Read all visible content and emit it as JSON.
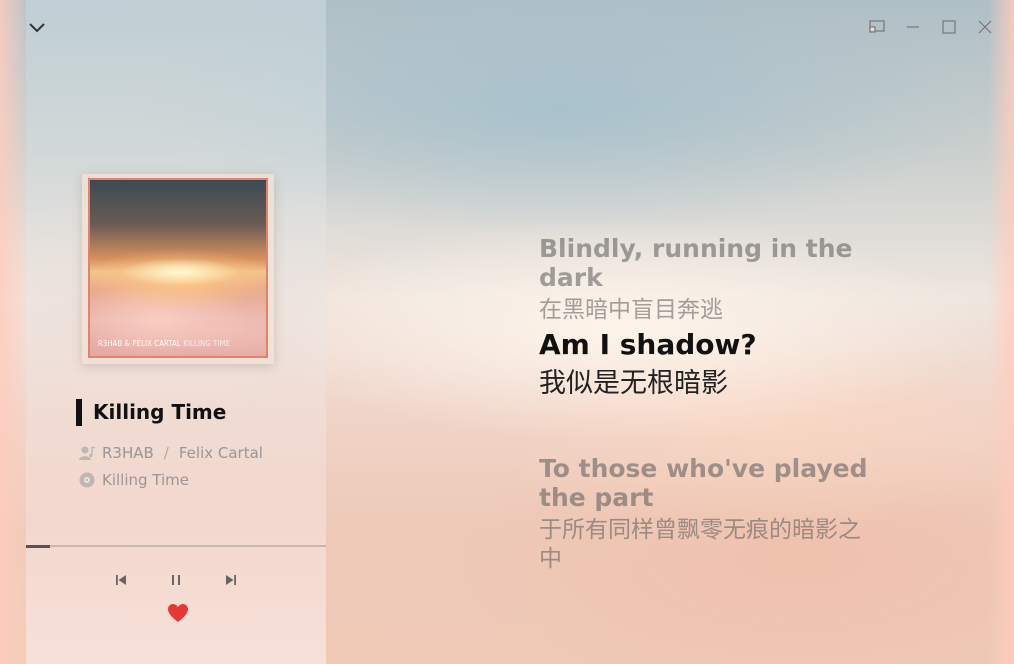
{
  "window": {
    "icons": [
      "cast-icon",
      "minimize-icon",
      "maximize-icon",
      "close-icon"
    ]
  },
  "player": {
    "cover_text_artist": "R3HAB & FELIX CARTAL",
    "cover_text_title": "KILLING TIME",
    "song_title": "Killing Time",
    "artists": [
      "R3HAB",
      "Felix Cartal"
    ],
    "artist_separator": "/",
    "album": "Killing Time",
    "progress_fraction": 0.08,
    "liked": true,
    "colors": {
      "heart": "#e53935",
      "title_bar": "#111111"
    }
  },
  "lyrics": [
    {
      "en": "Blindly, running in the dark",
      "zh": "在黑暗中盲目奔逃",
      "active": false
    },
    {
      "en": "Am I shadow?",
      "zh": "我似是无根暗影",
      "active": true
    },
    {
      "en": "To those who've played the part",
      "zh": "于所有同样曾飘零无痕的暗影之中",
      "active": false
    }
  ]
}
